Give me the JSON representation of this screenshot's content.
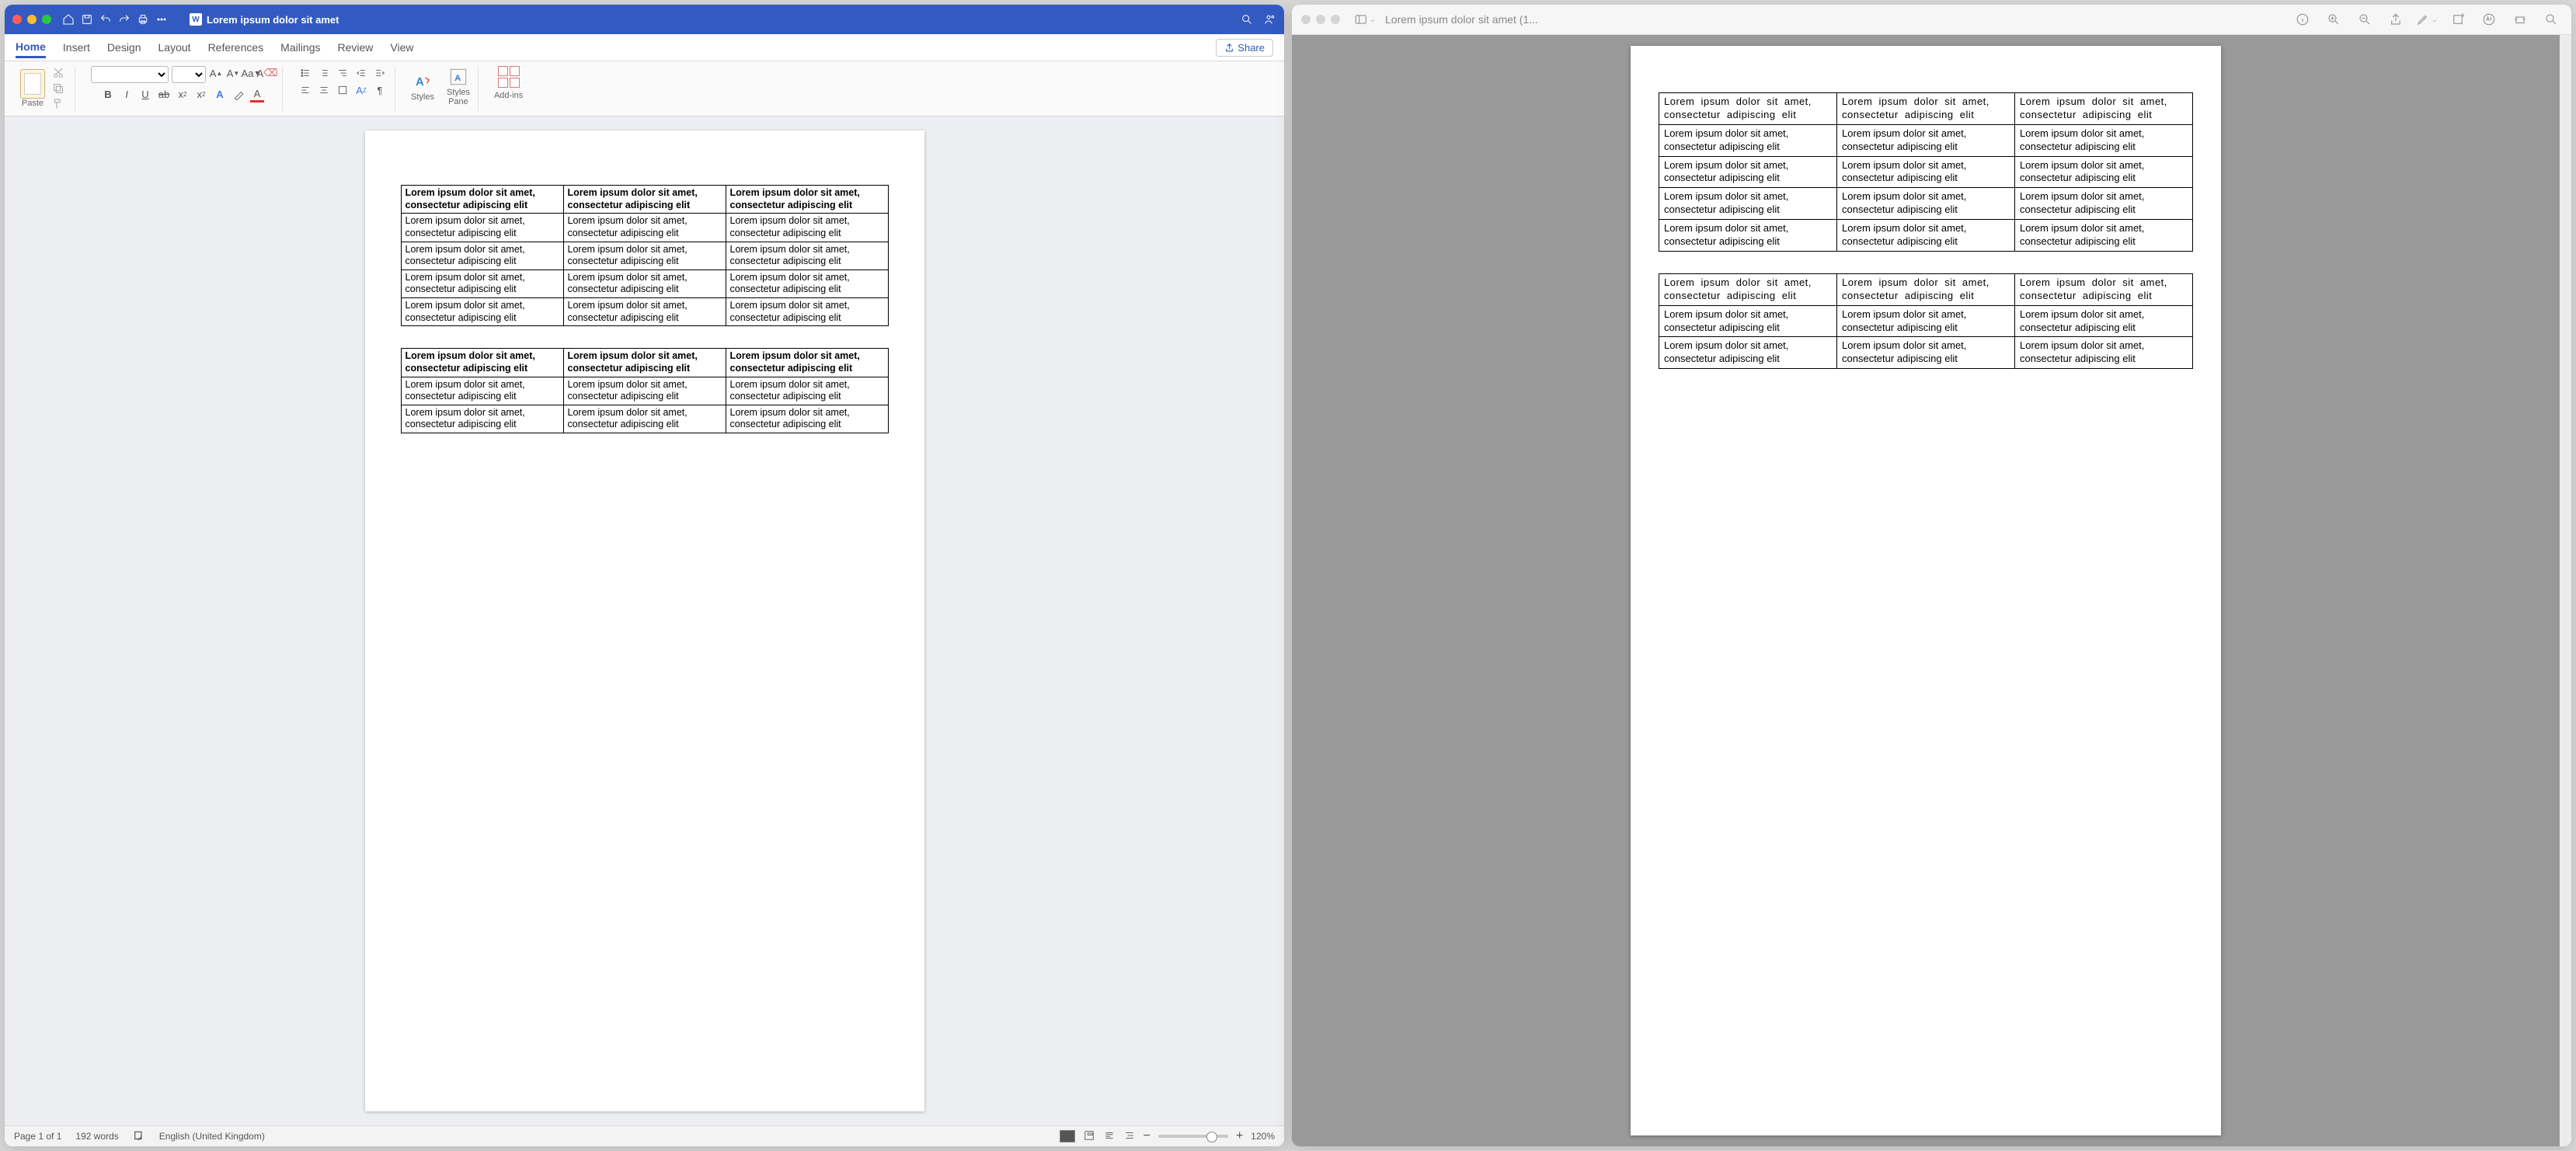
{
  "word": {
    "title": "Lorem ipsum dolor sit amet",
    "tabs": [
      "Home",
      "Insert",
      "Design",
      "Layout",
      "References",
      "Mailings",
      "Review",
      "View"
    ],
    "active_tab": 0,
    "share": "Share",
    "ribbon": {
      "paste": "Paste",
      "styles": "Styles",
      "styles_pane": "Styles\nPane",
      "addins": "Add-ins"
    },
    "status": {
      "page": "Page 1 of 1",
      "words": "192 words",
      "lang": "English (United Kingdom)",
      "zoom": "120%"
    },
    "header_cell": "Lorem ipsum dolor sit amet, consectetur adipiscing elit",
    "body_cell": "Lorem ipsum dolor sit amet, consectetur adipiscing elit",
    "table1_body_rows": 4,
    "table2_body_rows": 2
  },
  "preview": {
    "title": "Lorem ipsum dolor sit amet (1...",
    "header_cell": "Lorem ipsum dolor sit amet, consectetur adipiscing  elit",
    "body_cell": "Lorem ipsum dolor sit amet, consectetur adipiscing elit",
    "table1_body_rows": 4,
    "table2_body_rows": 2
  }
}
